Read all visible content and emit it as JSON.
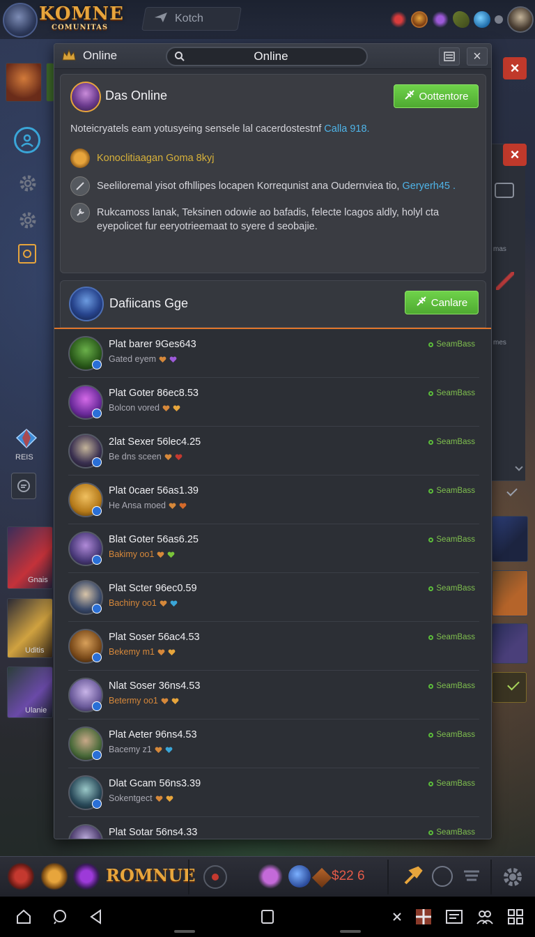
{
  "topbar": {
    "logo_line1": "KOMNE",
    "logo_line2": "COMUNITAS",
    "search_label": "Kotch"
  },
  "left_side": {
    "badge_label": "REIS",
    "thumb1_label": "Gnais",
    "thumb2_label": "Uditis",
    "thumb3_label": "Ulanie"
  },
  "right_side": {
    "item1_label": "mas",
    "item2_label": "mes"
  },
  "window": {
    "title": "Online",
    "search_value": "Online"
  },
  "card": {
    "title": "Das Online",
    "button_label": "Oottentore",
    "description": "Noteicryatels eam yotusyeing sensele lal cacerdostestnf",
    "description_link": "Calla 918.",
    "line1": "Konoclitiaagan Goma 8kyj",
    "line2": "Seeliloremal yisot ofhllipes locapen Korrequnist ana Oudernviea tio,",
    "line2_link": "Geryerh45 .",
    "line3a": "Rukcamoss lanak, Teksinen odowie ao bafadis, felecte lcagos aldly, holyl cta",
    "line3b": "eyepolicet fur eeryotrieemaat to syere d seobajie."
  },
  "section": {
    "title": "Dafiicans Gge",
    "button_label": "Canlare"
  },
  "rows": [
    {
      "name": "Plat barer 9Ges643",
      "sub": "Gated eyem",
      "status": "SeamBass",
      "orange": false
    },
    {
      "name": "Plat Goter 86ec8.53",
      "sub": "Bolcon vored",
      "status": "SeamBass",
      "orange": false
    },
    {
      "name": "2lat Sexer 56lec4.25",
      "sub": "Be dns sceen",
      "status": "SeamBass",
      "orange": false
    },
    {
      "name": "Plat 0caer 56as1.39",
      "sub": "He Ansa moed",
      "status": "SeamBass",
      "orange": false
    },
    {
      "name": "Blat Goter 56as6.25",
      "sub": "Bakimy oo1",
      "status": "SeamBass",
      "orange": true
    },
    {
      "name": "Plat Scter 96ec0.59",
      "sub": "Bachiny oo1",
      "status": "SeamBass",
      "orange": true
    },
    {
      "name": "Plat Soser 56ac4.53",
      "sub": "Bekemy m1",
      "status": "SeamBass",
      "orange": true
    },
    {
      "name": "Nlat Soser 36ns4.53",
      "sub": "Betermy oo1",
      "status": "SeamBass",
      "orange": true
    },
    {
      "name": "Plat Aeter 96ns4.53",
      "sub": "Bacemy z1",
      "status": "SeamBass",
      "orange": false
    },
    {
      "name": "Dlat Gcam 56ns3.39",
      "sub": "Sokentgect",
      "status": "SeamBass",
      "orange": false
    },
    {
      "name": "Plat Sotar 56ns4.33",
      "sub": "",
      "status": "SeamBass",
      "orange": false
    }
  ],
  "gamebar": {
    "logo": "ROMNUE",
    "coins": "$22 6"
  },
  "colors": {
    "accent_orange": "#e0752b",
    "accent_green": "#5bbd3a",
    "link_blue": "#4fb4e8",
    "close_red": "#c0392b"
  }
}
